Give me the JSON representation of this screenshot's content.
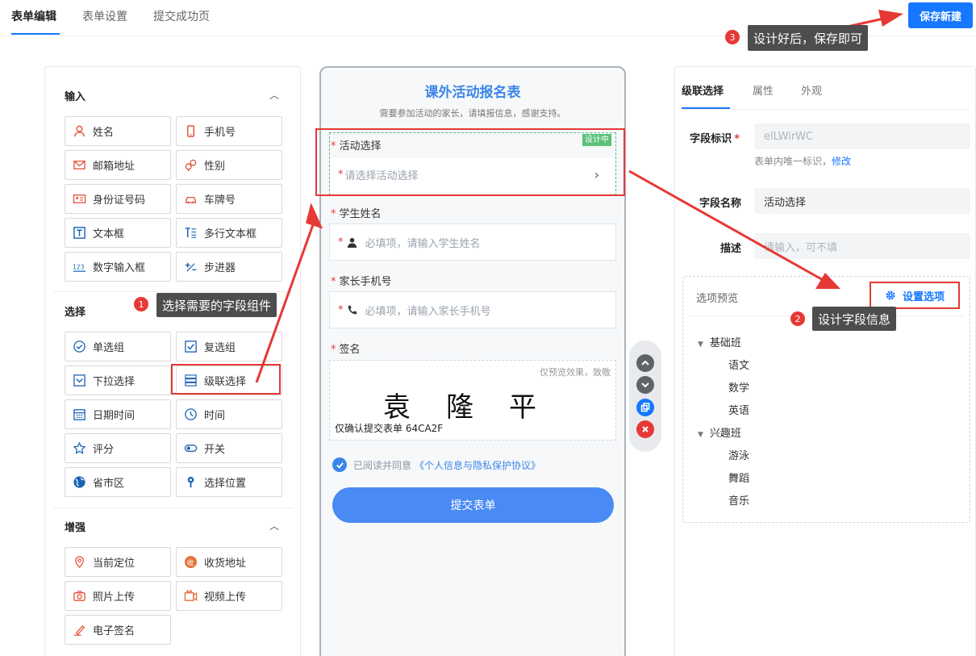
{
  "top_tabs": [
    "表单编辑",
    "表单设置",
    "提交成功页"
  ],
  "save_button": "保存新建",
  "left_panel": {
    "sections": [
      {
        "title": "输入",
        "items": [
          {
            "label": "姓名",
            "icon": "person-icon"
          },
          {
            "label": "手机号",
            "icon": "mobile-icon"
          },
          {
            "label": "邮箱地址",
            "icon": "mail-icon"
          },
          {
            "label": "性别",
            "icon": "gender-icon"
          },
          {
            "label": "身份证号码",
            "icon": "id-card-icon"
          },
          {
            "label": "车牌号",
            "icon": "car-icon"
          },
          {
            "label": "文本框",
            "icon": "text-box-icon"
          },
          {
            "label": "多行文本框",
            "icon": "multiline-text-icon"
          },
          {
            "label": "数字输入框",
            "icon": "number-input-icon"
          },
          {
            "label": "步进器",
            "icon": "stepper-icon"
          }
        ]
      },
      {
        "title": "选择",
        "items": [
          {
            "label": "单选组",
            "icon": "radio-icon"
          },
          {
            "label": "复选组",
            "icon": "checkbox-icon"
          },
          {
            "label": "下拉选择",
            "icon": "dropdown-icon"
          },
          {
            "label": "级联选择",
            "icon": "cascade-icon"
          },
          {
            "label": "日期时间",
            "icon": "calendar-icon"
          },
          {
            "label": "时间",
            "icon": "clock-icon"
          },
          {
            "label": "评分",
            "icon": "star-icon"
          },
          {
            "label": "开关",
            "icon": "toggle-icon"
          },
          {
            "label": "省市区",
            "icon": "globe-icon"
          },
          {
            "label": "选择位置",
            "icon": "pin-icon"
          }
        ]
      },
      {
        "title": "增强",
        "items": [
          {
            "label": "当前定位",
            "icon": "location-icon"
          },
          {
            "label": "收货地址",
            "icon": "delivery-icon"
          },
          {
            "label": "照片上传",
            "icon": "camera-icon"
          },
          {
            "label": "视频上传",
            "icon": "video-icon"
          },
          {
            "label": "电子签名",
            "icon": "signature-icon"
          }
        ]
      }
    ]
  },
  "form": {
    "title": "课外活动报名表",
    "subtitle": "需要参加活动的家长，请填报信息，感谢支持。",
    "design_tag": "设计中",
    "fields": [
      {
        "label": "活动选择",
        "placeholder": "请选择活动选择"
      },
      {
        "label": "学生姓名",
        "placeholder": "必填项，请输入学生姓名"
      },
      {
        "label": "家长手机号",
        "placeholder": "必填项，请输入家长手机号"
      },
      {
        "label": "签名"
      }
    ],
    "required_mark": "*",
    "signature": {
      "note": "仅预览效果，致敬",
      "name": "袁隆平",
      "code": "仅确认提交表单 64CA2F"
    },
    "agree_text": "已阅读并同意",
    "agree_link": "《个人信息与隐私保护协议》",
    "submit": "提交表单"
  },
  "right_panel": {
    "tabs": [
      "级联选择",
      "属性",
      "外观"
    ],
    "field_id_label": "字段标识",
    "field_id_value": "elLWirWC",
    "field_id_note": "表单内唯一标识，",
    "field_id_link": "修改",
    "field_name_label": "字段名称",
    "field_name_value": "活动选择",
    "desc_label": "描述",
    "desc_placeholder": "请输入，可不填",
    "options_title": "选项预览",
    "options_button": "设置选项",
    "tree": [
      {
        "label": "基础班",
        "children": [
          "语文",
          "数学",
          "英语"
        ]
      },
      {
        "label": "兴趣班",
        "children": [
          "游泳",
          "舞蹈",
          "音乐"
        ]
      }
    ]
  },
  "annotations": [
    {
      "num": "1",
      "text": "选择需要的字段组件"
    },
    {
      "num": "2",
      "text": "设计字段信息"
    },
    {
      "num": "3",
      "text": "设计好后，保存即可"
    }
  ],
  "colors": {
    "accent": "#1677ff",
    "annotation_red": "#e53935",
    "design_green": "#5ac17a"
  }
}
